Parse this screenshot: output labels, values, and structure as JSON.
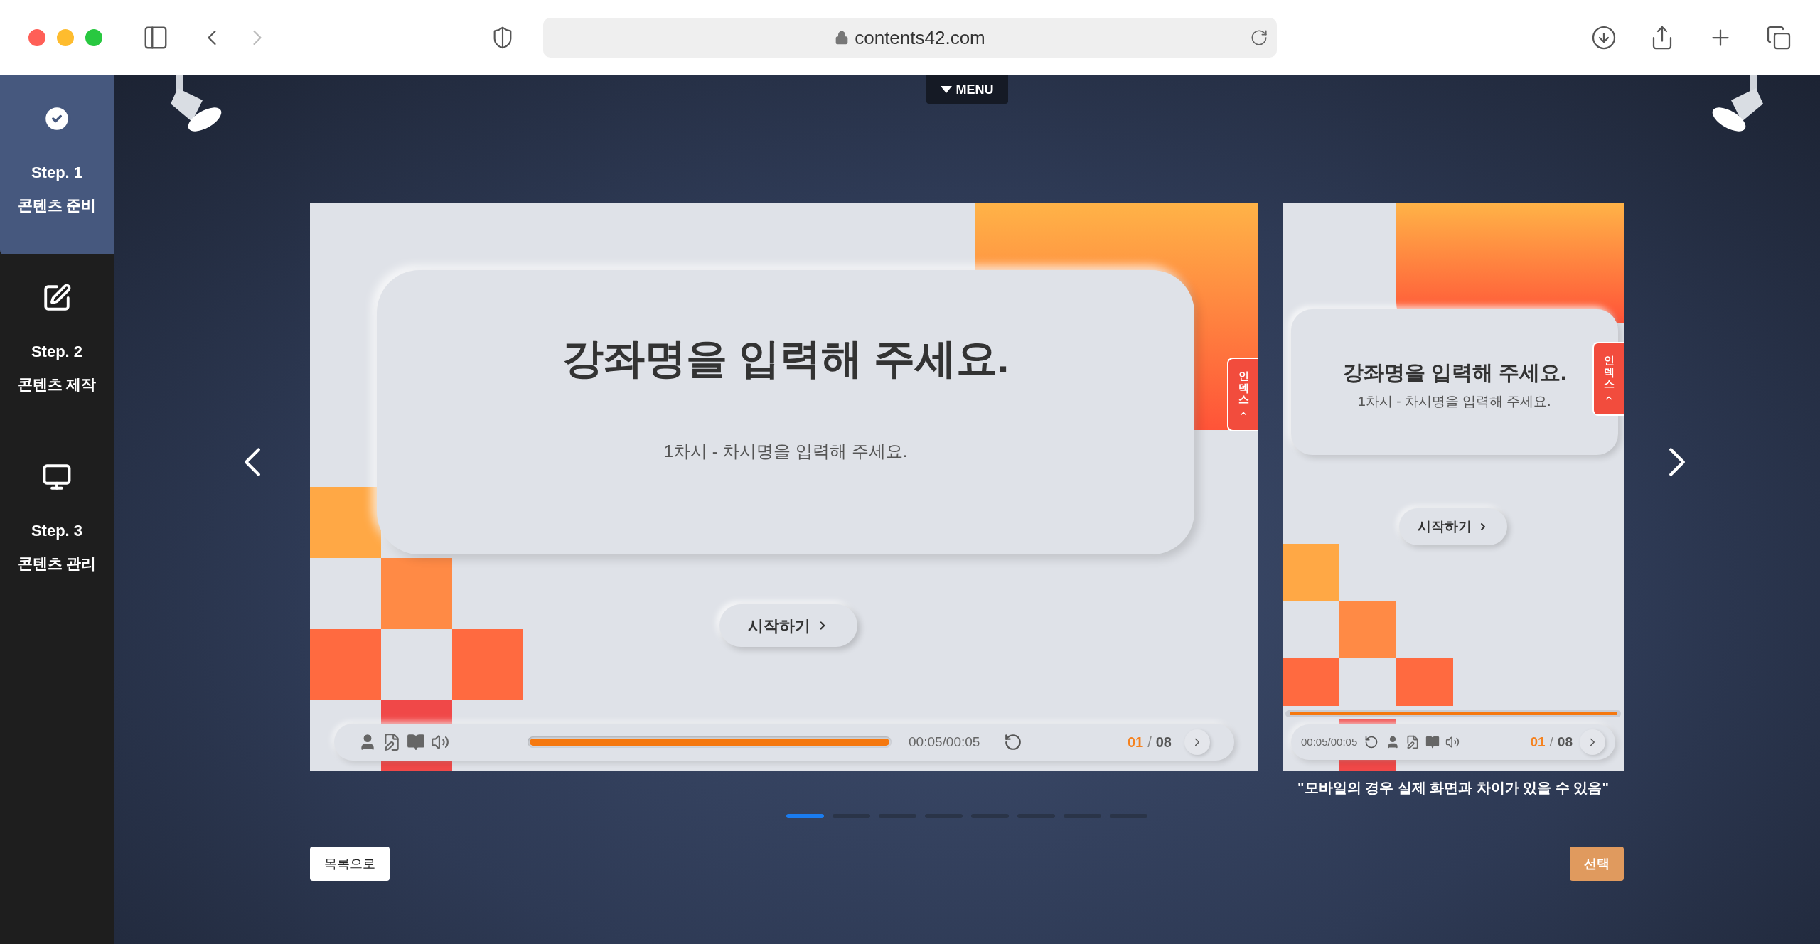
{
  "browser": {
    "url": "contents42.com"
  },
  "sidebar": {
    "steps": [
      {
        "step": "Step. 1",
        "label": "콘텐츠 준비",
        "selected": true
      },
      {
        "step": "Step. 2",
        "label": "콘텐츠 제작",
        "selected": false
      },
      {
        "step": "Step. 3",
        "label": "콘텐츠 관리",
        "selected": false
      }
    ]
  },
  "menu_tab": {
    "label": "MENU"
  },
  "previews": [
    {
      "kind": "desktop",
      "title": "강좌명을 입력해 주세요.",
      "subtitle": "1차시 - 차시명을 입력해 주세요.",
      "start_button": "시작하기",
      "index_tab": "인덱스",
      "player": {
        "time": "00:05/00:05",
        "current_page": "01",
        "separator": "/",
        "total_pages": "08",
        "level": 1
      }
    },
    {
      "kind": "mobile",
      "title": "강좌명을 입력해 주세요.",
      "subtitle": "1차시 - 차시명을 입력해 주세요.",
      "start_button": "시작하기",
      "index_tab": "인덱스",
      "player": {
        "time": "00:05/00:05",
        "current_page": "01",
        "separator": "/",
        "total_pages": "08",
        "level": 1
      }
    }
  ],
  "caption": "\"모바일의 경우 실제 화면과 차이가 있을 수 있음\"",
  "pagination": [
    {
      "selected": true
    },
    {
      "selected": false
    },
    {
      "selected": false
    },
    {
      "selected": false
    },
    {
      "selected": false
    },
    {
      "selected": false
    },
    {
      "selected": false
    },
    {
      "selected": false
    }
  ],
  "buttons": {
    "back": "목록으로",
    "select": "선택"
  }
}
